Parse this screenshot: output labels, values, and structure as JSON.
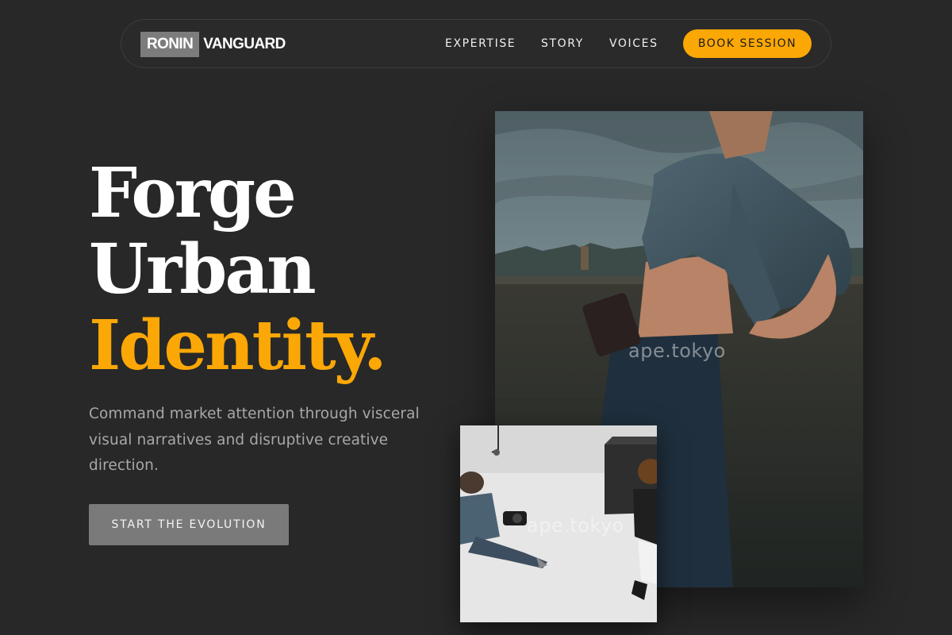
{
  "nav": {
    "logo_box": "RONIN",
    "logo_text": "VANGUARD",
    "links": [
      "EXPERTISE",
      "STORY",
      "VOICES"
    ],
    "cta": "BOOK SESSION"
  },
  "hero": {
    "headline": [
      "Forge",
      "Urban",
      "Identity."
    ],
    "lead": "Command market attention through visceral visual narratives and disruptive creative direction.",
    "cta": "START THE EVOLUTION"
  },
  "images": {
    "main": {
      "subject": "woman-in-denim-jacket-rooftop-photo",
      "watermark": "ape.tokyo"
    },
    "inset": {
      "subject": "photographer-studio-shoot-photo",
      "watermark": "ape.tokyo"
    }
  },
  "colors": {
    "background": "#282828",
    "accent": "#fba706",
    "button_gray": "#7a7a7a",
    "text_muted": "#a8a8ac"
  }
}
